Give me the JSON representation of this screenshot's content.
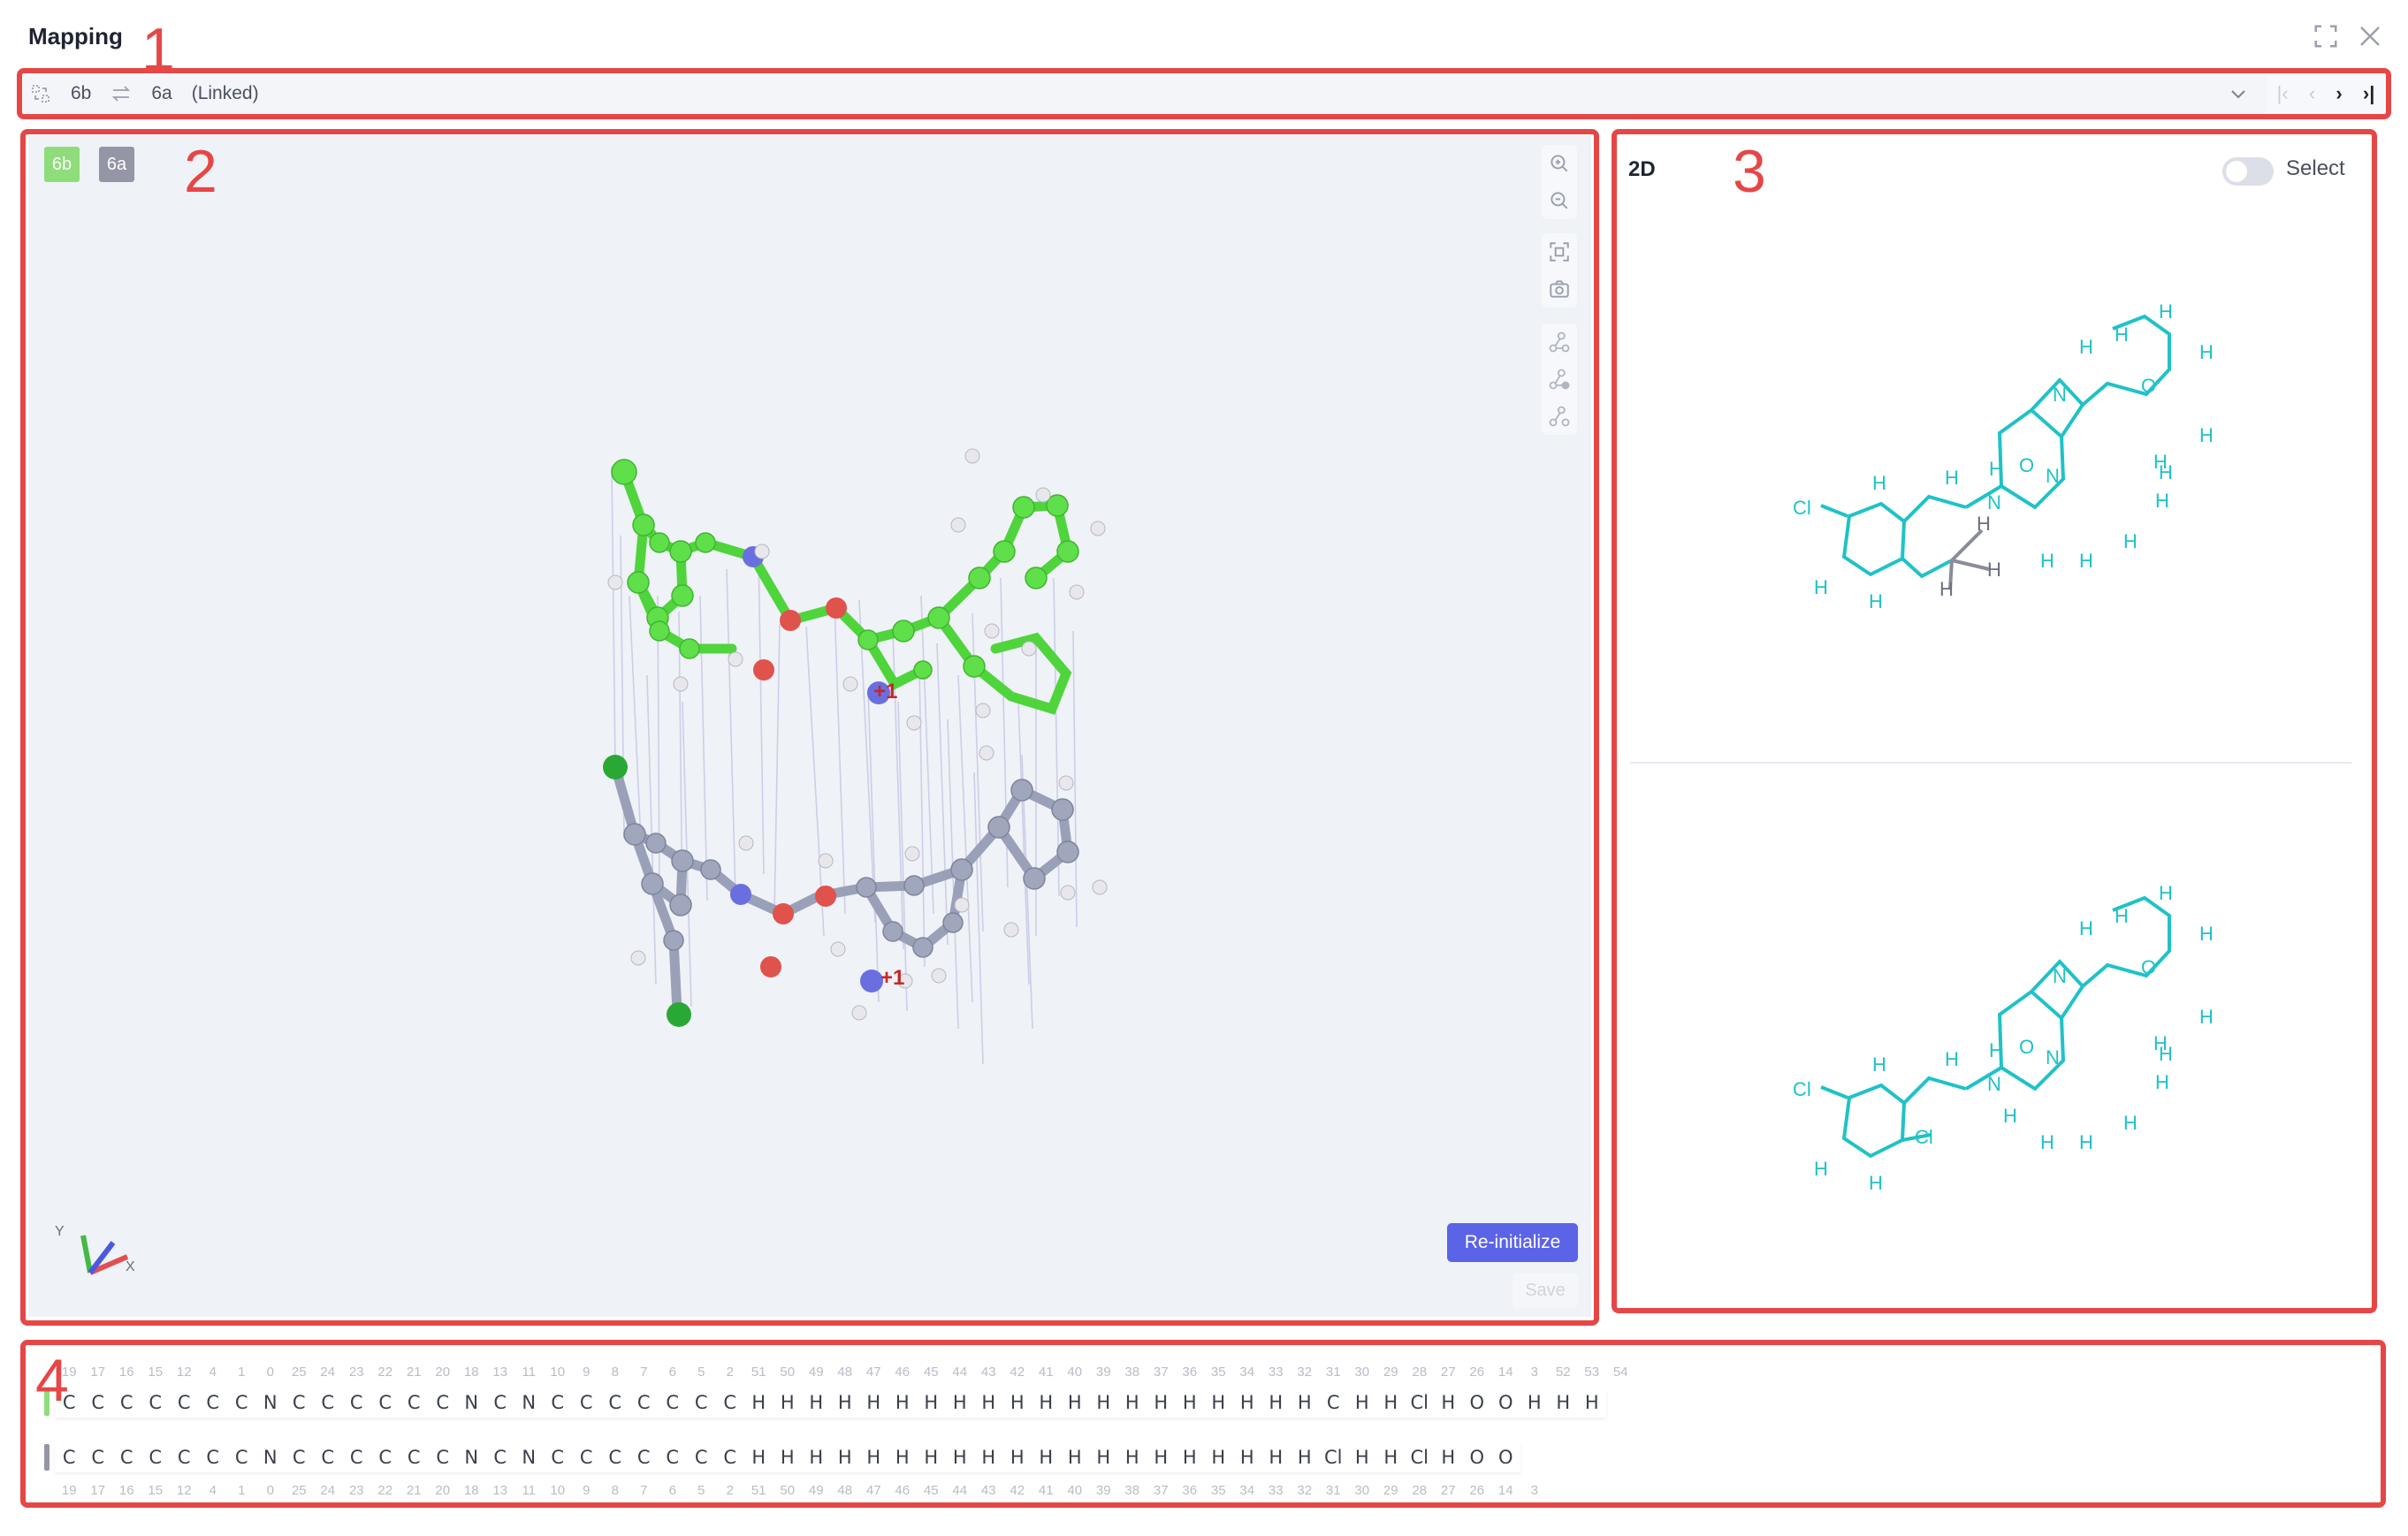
{
  "window": {
    "title": "Mapping"
  },
  "toolbar": {
    "mol_a": "6b",
    "mol_b": "6a",
    "link_status": "(Linked)"
  },
  "annotations": [
    "1",
    "2",
    "3",
    "4"
  ],
  "viewer": {
    "tag_a": "6b",
    "tag_b": "6a",
    "reinit_label": "Re-initialize",
    "save_label": "Save",
    "axis_x": "X",
    "axis_y": "Y",
    "charge_top": "+1",
    "charge_bottom": "+1"
  },
  "panel2d": {
    "title": "2D",
    "select_label": "Select"
  },
  "labels2d": {
    "cl": "Cl",
    "h": "H",
    "n": "N",
    "o": "O"
  },
  "colors": {
    "accent": "#5b63e6",
    "annotation": "#e64646",
    "mol2d": "#1fc2c8",
    "mol_a": "#4fd43c",
    "mol_b": "#9aa0b8"
  },
  "sequence": {
    "top_indices": [
      "19",
      "17",
      "16",
      "15",
      "12",
      "4",
      "1",
      "0",
      "25",
      "24",
      "23",
      "22",
      "21",
      "20",
      "18",
      "13",
      "11",
      "10",
      "9",
      "8",
      "7",
      "6",
      "5",
      "2",
      "51",
      "50",
      "49",
      "48",
      "47",
      "46",
      "45",
      "44",
      "43",
      "42",
      "41",
      "40",
      "39",
      "38",
      "37",
      "36",
      "35",
      "34",
      "33",
      "32",
      "31",
      "30",
      "29",
      "28",
      "27",
      "26",
      "14",
      "3",
      "52",
      "53",
      "54"
    ],
    "top_atoms": [
      "C",
      "C",
      "C",
      "C",
      "C",
      "C",
      "C",
      "N",
      "C",
      "C",
      "C",
      "C",
      "C",
      "C",
      "N",
      "C",
      "N",
      "C",
      "C",
      "C",
      "C",
      "C",
      "C",
      "C",
      "H",
      "H",
      "H",
      "H",
      "H",
      "H",
      "H",
      "H",
      "H",
      "H",
      "H",
      "H",
      "H",
      "H",
      "H",
      "H",
      "H",
      "H",
      "H",
      "H",
      "C",
      "H",
      "H",
      "Cl",
      "H",
      "O",
      "O",
      "H",
      "H",
      "H"
    ],
    "bottom_atoms": [
      "C",
      "C",
      "C",
      "C",
      "C",
      "C",
      "C",
      "N",
      "C",
      "C",
      "C",
      "C",
      "C",
      "C",
      "N",
      "C",
      "N",
      "C",
      "C",
      "C",
      "C",
      "C",
      "C",
      "C",
      "H",
      "H",
      "H",
      "H",
      "H",
      "H",
      "H",
      "H",
      "H",
      "H",
      "H",
      "H",
      "H",
      "H",
      "H",
      "H",
      "H",
      "H",
      "H",
      "H",
      "Cl",
      "H",
      "H",
      "Cl",
      "H",
      "O",
      "O"
    ],
    "bottom_indices": [
      "19",
      "17",
      "16",
      "15",
      "12",
      "4",
      "1",
      "0",
      "25",
      "24",
      "23",
      "22",
      "21",
      "20",
      "18",
      "13",
      "11",
      "10",
      "9",
      "8",
      "7",
      "6",
      "5",
      "2",
      "51",
      "50",
      "49",
      "48",
      "47",
      "46",
      "45",
      "44",
      "43",
      "42",
      "41",
      "40",
      "39",
      "38",
      "37",
      "36",
      "35",
      "34",
      "33",
      "32",
      "31",
      "30",
      "29",
      "28",
      "27",
      "26",
      "14",
      "3"
    ]
  }
}
